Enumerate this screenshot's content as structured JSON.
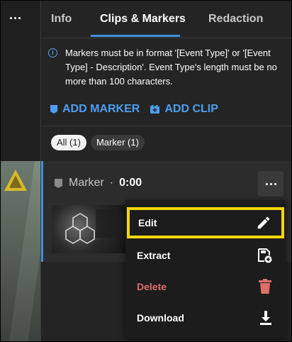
{
  "left": {
    "more_label": "more options"
  },
  "tabs": [
    {
      "label": "Info"
    },
    {
      "label": "Clips & Markers"
    },
    {
      "label": "Redaction"
    }
  ],
  "active_tab": "Clips & Markers",
  "info_text": "Markers must be in format '[Event Type]' or '[Event Type] - Description'. Event Type's length must be no more than 100 characters.",
  "actions": {
    "add_marker": "ADD MARKER",
    "add_clip": "ADD CLIP"
  },
  "filters": [
    {
      "label": "All (1)",
      "active": true
    },
    {
      "label": "Marker (1)",
      "active": false
    }
  ],
  "item": {
    "type_label": "Marker",
    "separator": "·",
    "time": "0:00"
  },
  "menu": {
    "edit": "Edit",
    "extract": "Extract",
    "delete": "Delete",
    "download": "Download"
  },
  "colors": {
    "accent": "#3d8fe0",
    "link": "#4d9ef0",
    "highlight": "#f5d60a",
    "danger": "#e06f6a"
  }
}
